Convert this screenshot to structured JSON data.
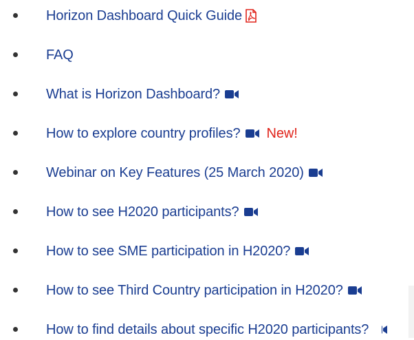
{
  "links": [
    {
      "label": "Horizon Dashboard Quick Guide",
      "icon": "pdf-icon"
    },
    {
      "label": "FAQ",
      "icon": ""
    },
    {
      "label": "What is Horizon Dashboard?",
      "icon": "video-camera-icon"
    },
    {
      "label": "How to explore country profiles?",
      "icon": "video-camera-icon",
      "badge": "New!"
    },
    {
      "label": "Webinar on Key Features (25 March 2020)",
      "icon": "video-camera-icon"
    },
    {
      "label": "How to see H2020 participants?",
      "icon": "video-camera-icon"
    },
    {
      "label": "How to see SME participation in H2020?",
      "icon": "video-camera-icon"
    },
    {
      "label": "How to see Third Country participation in H2020?",
      "icon": "video-camera-icon"
    },
    {
      "label": "How to find details about specific H2020 participants?",
      "icon": "video-camera-icon"
    }
  ],
  "colors": {
    "link": "#1a3d91",
    "badge": "#e0231a",
    "pdf": "#e0231a",
    "video": "#1a3d91"
  }
}
